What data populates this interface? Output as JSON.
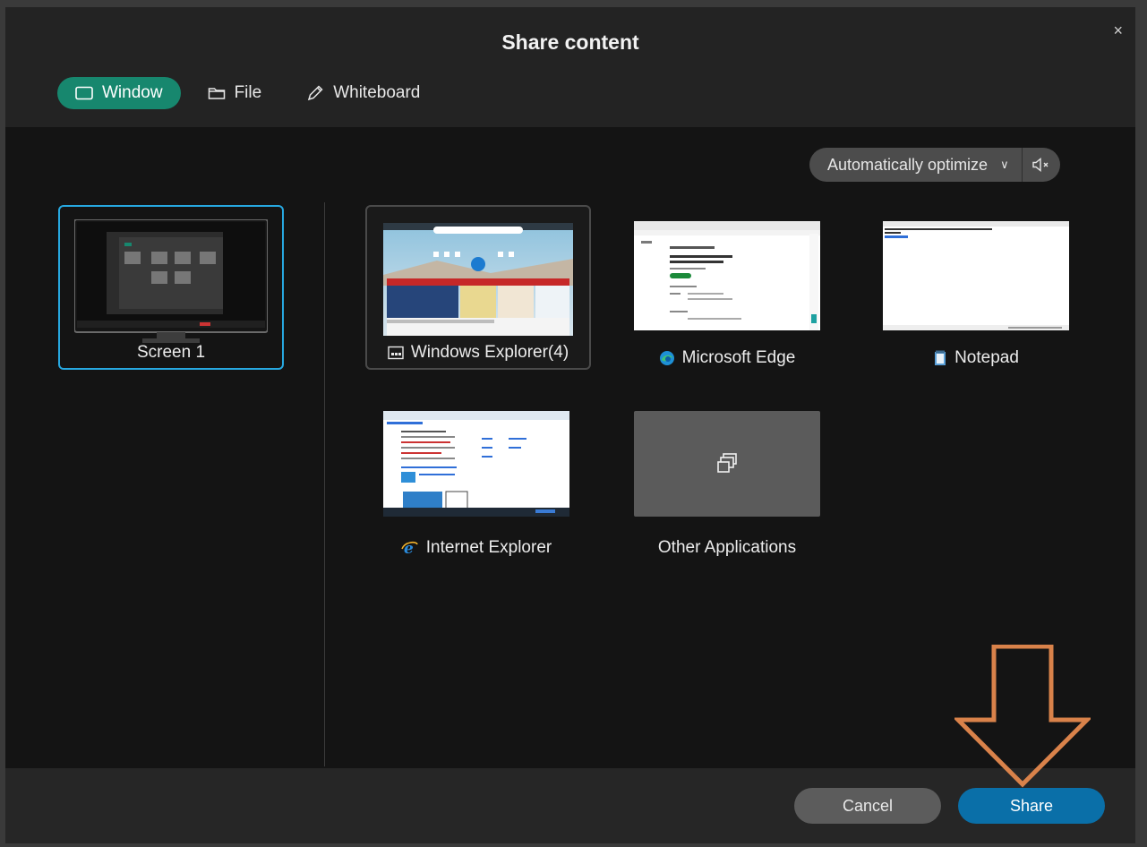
{
  "dialog": {
    "title": "Share content",
    "close_label": "×"
  },
  "tabs": [
    {
      "label": "Window",
      "icon": "window-icon",
      "active": true
    },
    {
      "label": "File",
      "icon": "folder-icon",
      "active": false
    },
    {
      "label": "Whiteboard",
      "icon": "pen-icon",
      "active": false
    }
  ],
  "options": {
    "optimize_label": "Automatically optimize",
    "optimize_chevron": "∨",
    "audio_icon": "speaker-muted-icon"
  },
  "screens": [
    {
      "label": "Screen 1",
      "selected": true
    }
  ],
  "windows": [
    {
      "label": "Windows Explorer(4)",
      "icon": "explorer-icon"
    },
    {
      "label": "Microsoft Edge",
      "icon": "edge-icon"
    },
    {
      "label": "Notepad",
      "icon": "notepad-icon"
    },
    {
      "label": "Internet Explorer",
      "icon": "ie-icon"
    },
    {
      "label": "Other Applications",
      "icon": "multi-window-icon"
    }
  ],
  "footer": {
    "cancel_label": "Cancel",
    "share_label": "Share"
  },
  "colors": {
    "accent": "#17876e",
    "selection": "#27a8e0",
    "share_button": "#0a6fa8",
    "annotation_arrow": "#d9824a"
  }
}
